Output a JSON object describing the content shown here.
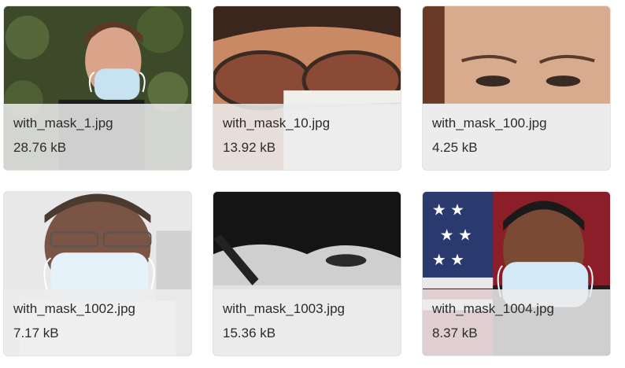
{
  "gallery": {
    "items": [
      {
        "filename": "with_mask_1.jpg",
        "size": "28.76 kB"
      },
      {
        "filename": "with_mask_10.jpg",
        "size": "13.92 kB"
      },
      {
        "filename": "with_mask_100.jpg",
        "size": "4.25 kB"
      },
      {
        "filename": "with_mask_1002.jpg",
        "size": "7.17 kB"
      },
      {
        "filename": "with_mask_1003.jpg",
        "size": "15.36 kB"
      },
      {
        "filename": "with_mask_1004.jpg",
        "size": "8.37 kB"
      }
    ]
  }
}
